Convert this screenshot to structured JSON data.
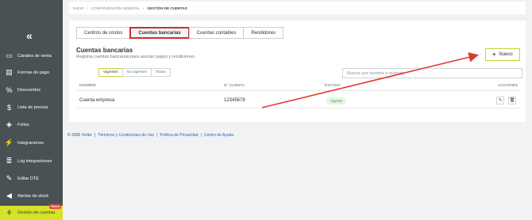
{
  "sidebar": {
    "collapse_glyph": "«",
    "items": [
      {
        "label": "Canales de venta",
        "icon": "monitor-icon",
        "glyph": "▭"
      },
      {
        "label": "Formas de pago",
        "icon": "card-icon",
        "glyph": "▤"
      },
      {
        "label": "Descuentos",
        "icon": "percent-icon",
        "glyph": "%"
      },
      {
        "label": "Lista de precios",
        "icon": "dollar-icon",
        "glyph": "$"
      },
      {
        "label": "Folios",
        "icon": "tag-icon",
        "glyph": "◈"
      },
      {
        "label": "Integraciones",
        "icon": "plug-icon",
        "glyph": "⚡"
      },
      {
        "label": "Log integraciones",
        "icon": "list-icon",
        "glyph": "≣"
      },
      {
        "label": "Editar DTE",
        "icon": "wrench-icon",
        "glyph": "✎"
      },
      {
        "label": "Alertas de stock",
        "icon": "megaphone-icon",
        "glyph": "◀"
      },
      {
        "label": "Gestión de cuentas",
        "icon": "sitemap-icon",
        "glyph": "⚘",
        "badge": "Nuevo"
      }
    ]
  },
  "breadcrumb": {
    "items": [
      "INICIO",
      "CONFIGURACIÓN GENERAL",
      "GESTIÓN DE CUENTAS"
    ],
    "separator": "/"
  },
  "tabs": [
    "Centros de costos",
    "Cuentas bancarias",
    "Cuentas contables",
    "Rendidores"
  ],
  "active_tab": "Cuentas bancarias",
  "section": {
    "title": "Cuentas bancarias",
    "subtitle": "Registra cuentas bancarias para asociar pagos y rendiciones."
  },
  "new_button": {
    "plus": "+",
    "label": "Nuevo"
  },
  "filters": [
    "Vigentes",
    "No vigentes",
    "Todos"
  ],
  "search": {
    "placeholder": "Buscar por nombre o número",
    "value": ""
  },
  "table": {
    "headers": {
      "name": "NOMBRE",
      "number": "N° CUENTA",
      "status": "ESTADO",
      "actions": "ACCIONES"
    },
    "rows": [
      {
        "name": "Cuenta empresa",
        "number": "12345678",
        "status": "Vigente"
      }
    ]
  },
  "footer": {
    "copyright": "© 2026",
    "brand": "Relke",
    "links": [
      "Términos y Condiciones de Uso",
      "Política de Privacidad",
      "Centro de Ayuda"
    ]
  },
  "colors": {
    "sidebar": "#4a5155",
    "active": "#d6e12a",
    "highlight": "#d32c2c",
    "status_green": "#3d9a4b"
  }
}
